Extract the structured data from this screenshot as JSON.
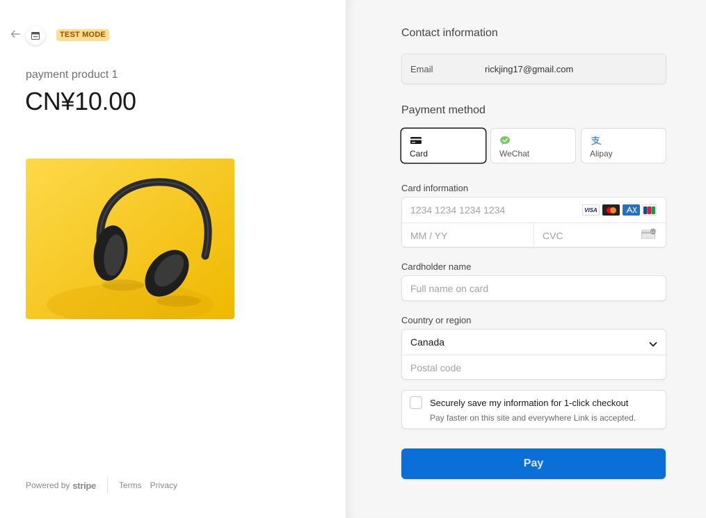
{
  "header": {
    "back_icon": "arrow-left-icon",
    "store_icon": "store-icon",
    "test_mode_label": "TEST MODE"
  },
  "product": {
    "name": "payment product 1",
    "price": "CN¥10.00",
    "image_icon": "headphones-image"
  },
  "footer": {
    "powered_by": "Powered by",
    "brand": "stripe",
    "terms": "Terms",
    "privacy": "Privacy"
  },
  "contact": {
    "title": "Contact information",
    "email_label": "Email",
    "email_value": "rickjing17@gmail.com"
  },
  "payment_method": {
    "title": "Payment method",
    "options": [
      {
        "label": "Card",
        "icon": "credit-card-icon",
        "selected": true
      },
      {
        "label": "WeChat",
        "icon": "wechat-icon",
        "selected": false
      },
      {
        "label": "Alipay",
        "icon": "alipay-icon",
        "selected": false
      }
    ]
  },
  "card": {
    "label": "Card information",
    "number_placeholder": "1234 1234 1234 1234",
    "expiry_placeholder": "MM / YY",
    "cvc_placeholder": "CVC",
    "brands": [
      "VISA",
      "mastercard",
      "amex",
      "JCB"
    ]
  },
  "cardholder": {
    "label": "Cardholder name",
    "placeholder": "Full name on card"
  },
  "country": {
    "label": "Country or region",
    "selected": "Canada",
    "postal_placeholder": "Postal code"
  },
  "save_info": {
    "title": "Securely save my information for 1-click checkout",
    "subtitle": "Pay faster on this site and everywhere Link is accepted.",
    "checked": false
  },
  "pay_button": {
    "label": "Pay"
  },
  "colors": {
    "accent": "#0a6fd6",
    "badge_bg": "#ffde92",
    "badge_text": "#a04b00"
  }
}
